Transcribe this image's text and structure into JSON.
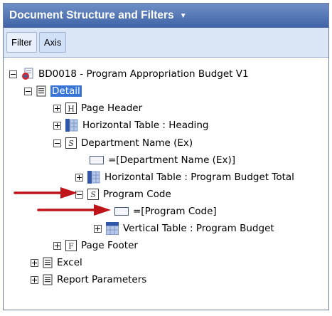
{
  "panel": {
    "title": "Document Structure and Filters",
    "title_caret": "▼"
  },
  "tabs": [
    {
      "label": "Filter"
    },
    {
      "label": "Axis"
    }
  ],
  "tree": {
    "root": "BD0018 - Program Appropriation Budget V1",
    "detail": "Detail",
    "page_header": "Page Header",
    "horizontal_heading": "Horizontal Table : Heading",
    "department_section": "Department Name (Ex)",
    "department_cell": "=[Department Name (Ex)]",
    "horizontal_total": "Horizontal Table : Program Budget Total",
    "program_section": "Program Code",
    "program_cell": "=[Program Code]",
    "vertical_table": "Vertical Table : Program Budget",
    "page_footer": "Page Footer",
    "excel": "Excel",
    "report_parameters": "Report Parameters"
  },
  "icon_letters": {
    "header": "H",
    "section": "S",
    "footer": "F"
  },
  "colors": {
    "header_bg": "#3f63a6",
    "selection": "#3875d7",
    "arrow": "#c0141b"
  }
}
